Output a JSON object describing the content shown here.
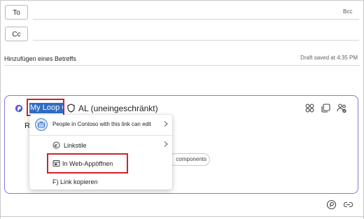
{
  "compose": {
    "to_label": "To",
    "cc_label": "Cc",
    "bcc_label": "Bcc",
    "subject_placeholder": "Hinzufügen eines Betreffs",
    "draft_status": "Draft saved at 4:35 PM"
  },
  "loop_component": {
    "title": "My Loop C",
    "sensitivity_label": "AL (uneingeschränkt)",
    "behind_text": "Re",
    "pill_label": "components",
    "accent_color": "#8c74d6",
    "selection_color": "#2f6cc4"
  },
  "share_menu": {
    "scope_text": "People in Contoso with this link can edit",
    "items": [
      {
        "label": "Linkstile",
        "icon": "link-style-icon"
      },
      {
        "label": "In Web-Appöffnen",
        "icon": "open-web-icon"
      },
      {
        "label": "F) Link kopieren",
        "icon": ""
      }
    ],
    "highlight_color": "#d0212a"
  },
  "icons": {
    "card_actions": [
      "components-icon",
      "copy-icon",
      "share-people-icon"
    ],
    "footer": [
      "loop-icon",
      "link-icon"
    ]
  }
}
